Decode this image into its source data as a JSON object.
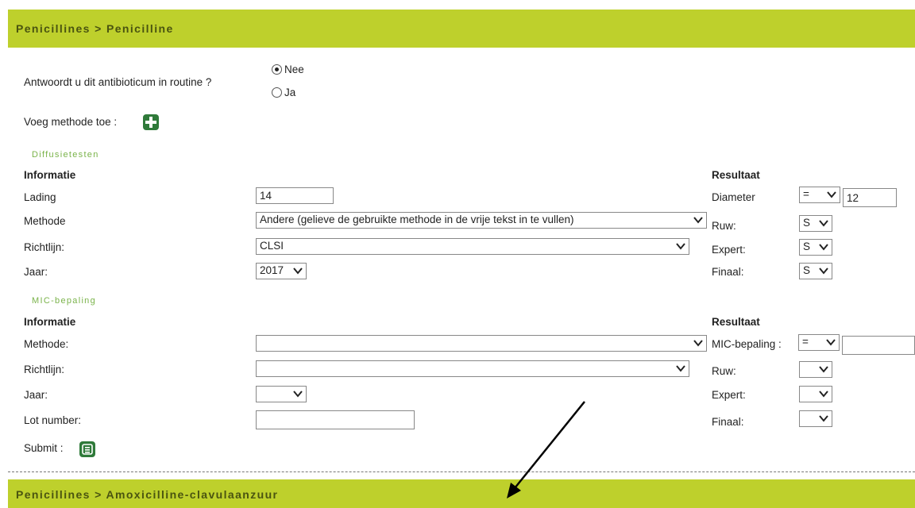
{
  "header": {
    "breadcrumb": "Penicillines > Penicilline"
  },
  "routine": {
    "question": "Antwoordt u dit antibioticum in routine ?",
    "options": [
      "Nee",
      "Ja"
    ],
    "selected": "Nee"
  },
  "add_method": {
    "label": "Voeg methode toe :"
  },
  "diffusion": {
    "section_title": "Diffusietesten",
    "info_heading": "Informatie",
    "result_heading": "Resultaat",
    "lading_label": "Lading",
    "lading_value": "14",
    "methode_label": "Methode",
    "methode_value": "Andere (gelieve de gebruikte methode in de vrije tekst in te vullen)",
    "richtlijn_label": "Richtlijn:",
    "richtlijn_value": "CLSI",
    "jaar_label": "Jaar:",
    "jaar_value": "2017",
    "diameter_label": "Diameter",
    "diameter_op": "=",
    "diameter_value": "12",
    "ruw_label": "Ruw:",
    "ruw_value": "S",
    "expert_label": "Expert:",
    "expert_value": "S",
    "finaal_label": "Finaal:",
    "finaal_value": "S"
  },
  "mic": {
    "section_title": "MIC-bepaling",
    "info_heading": "Informatie",
    "result_heading": "Resultaat",
    "methode_label": "Methode:",
    "methode_value": "",
    "richtlijn_label": "Richtlijn:",
    "richtlijn_value": "",
    "jaar_label": "Jaar:",
    "jaar_value": "",
    "lot_label": "Lot number:",
    "lot_value": "",
    "mic_label": "MIC-bepaling :",
    "mic_op": "=",
    "mic_value": "",
    "ruw_label": "Ruw:",
    "ruw_value": "",
    "expert_label": "Expert:",
    "expert_value": "",
    "finaal_label": "Finaal:",
    "finaal_value": ""
  },
  "submit": {
    "label": "Submit :"
  },
  "next_section": {
    "breadcrumb": "Penicillines > Amoxicilline-clavulaanzuur"
  },
  "colors": {
    "band": "#bed02c",
    "band_text": "#4a5410",
    "icon": "#2f7a3a",
    "section_title": "#7ab34a"
  }
}
